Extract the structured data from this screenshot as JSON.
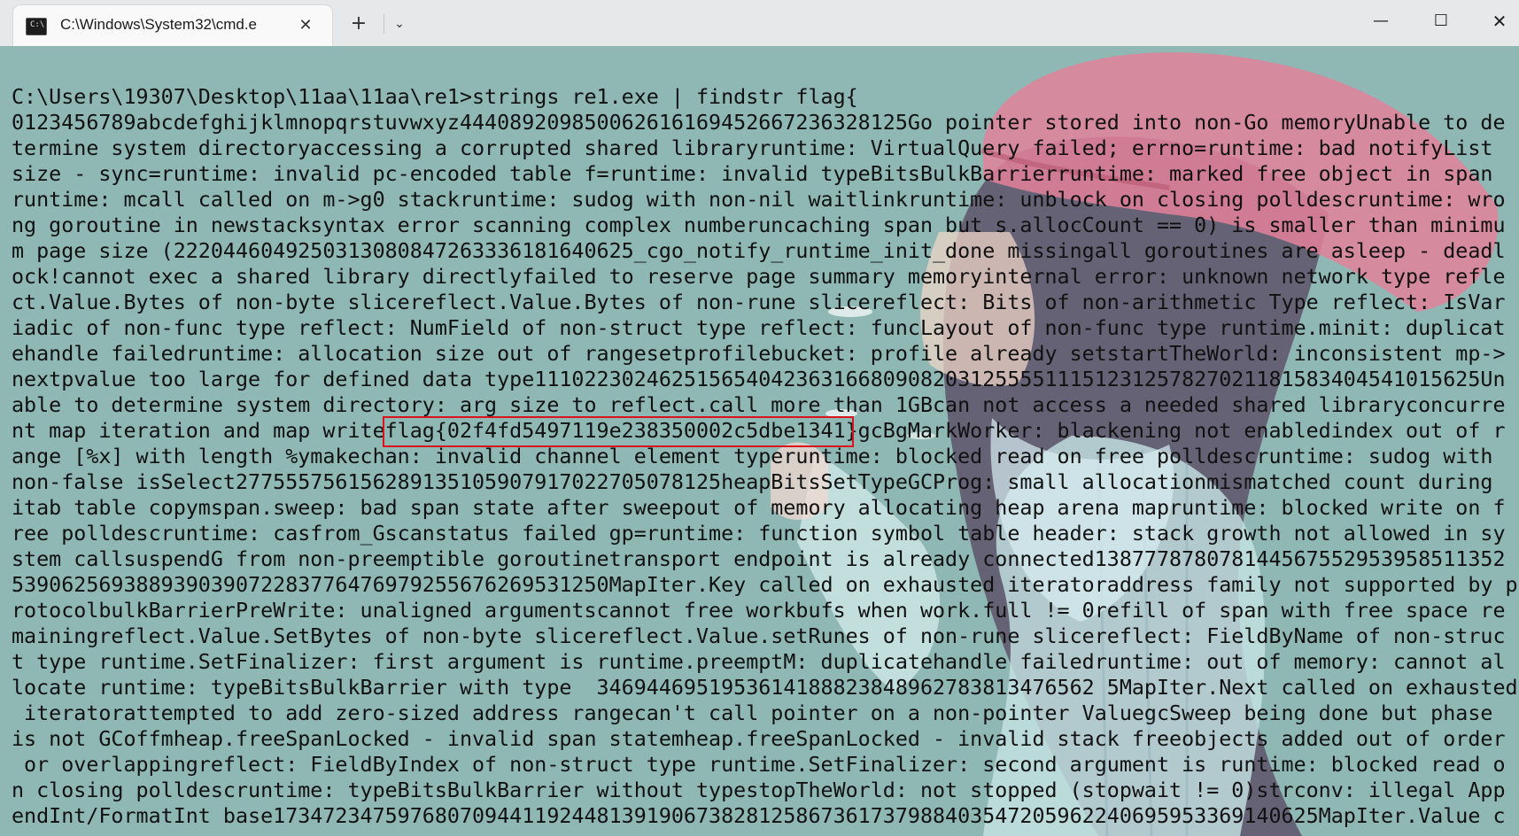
{
  "window": {
    "tab_title": "C:\\Windows\\System32\\cmd.e",
    "tab_icon_glyph": "C:\\",
    "close_tab_glyph": "✕",
    "new_tab_glyph": "+",
    "dropdown_glyph": "⌄",
    "minimize_glyph": "—",
    "maximize_glyph": "☐",
    "close_glyph": "✕"
  },
  "console": {
    "background_color": "#8fb8b5",
    "text_color": "#111111",
    "highlight_color": "#d8141c",
    "lines": [
      "C:\\Users\\19307\\Desktop\\11aa\\11aa\\re1>strings re1.exe | findstr flag{",
      "0123456789abcdefghijklmnopqrstuvwxyz444089209850062616169452667236328125Go pointer stored into non-Go memoryUnable to de",
      "termine system directoryaccessing a corrupted shared libraryruntime: VirtualQuery failed; errno=runtime: bad notifyList",
      "size - sync=runtime: invalid pc-encoded table f=runtime: invalid typeBitsBulkBarrierruntime: marked free object in span",
      "runtime: mcall called on m->g0 stackruntime: sudog with non-nil waitlinkruntime: unblock on closing polldescruntime: wro",
      "ng goroutine in newstacksyntax error scanning complex numberuncaching span but s.allocCount == 0) is smaller than minimu",
      "m page size (2220446049250313080847263336181640625_cgo_notify_runtime_init_done missingall goroutines are asleep - deadl",
      "ock!cannot exec a shared library directlyfailed to reserve page summary memoryinternal error: unknown network type refle",
      "ct.Value.Bytes of non-byte slicereflect.Value.Bytes of non-rune slicereflect: Bits of non-arithmetic Type reflect: IsVar",
      "iadic of non-func type reflect: NumField of non-struct type reflect: funcLayout of non-func type runtime.minit: duplicat",
      "ehandle failedruntime: allocation size out of rangesetprofilebucket: profile already setstartTheWorld: inconsistent mp->",
      "nextpvalue too large for defined data type1110223024625156540423631668090820312555511151231257827021181583404541015625Un",
      "able to determine system directory: arg size to reflect.call more than 1GBcan not access a needed shared libraryconcurre",
      "nt map iteration and map writeflag{02f4fd5497119e238350002c5dbe1341}gcBgMarkWorker: blackening not enabledindex out of r",
      "ange [%x] with length %ymakechan: invalid channel element typeruntime: blocked read on free polldescruntime: sudog with",
      "non-false isSelect277555756156289135105907917022705078125heapBitsSetTypeGCProg: small allocationmismatched count during",
      "itab table copymspan.sweep: bad span state after sweepout of memory allocating heap arena mapruntime: blocked write on f",
      "ree polldescruntime: casfrom_Gscanstatus failed gp=runtime: function symbol table header: stack growth not allowed in sy",
      "stem callsuspendG from non-preemptible goroutinetransport endpoint is already connected138777878078144567552953958511352",
      "539062569388939039072283776476979255676269531250MapIter.Key called on exhausted iteratoraddress family not supported by p",
      "rotocolbulkBarrierPreWrite: unaligned argumentscannot free workbufs when work.full != 0refill of span with free space re",
      "mainingreflect.Value.SetBytes of non-byte slicereflect.Value.setRunes of non-rune slicereflect: FieldByName of non-struc",
      "t type runtime.SetFinalizer: first argument is runtime.preemptM: duplicatehandle failedruntime: out of memory: cannot al",
      "locate runtime: typeBitsBulkBarrier with type  3469446951953614188823848962783813476562 5MapIter.Next called on exhausted",
      " iteratorattempted to add zero-sized address rangecan't call pointer on a non-pointer ValuegcSweep being done but phase",
      "is not GCoffmheap.freeSpanLocked - invalid span statemheap.freeSpanLocked - invalid stack freeobjects added out of order",
      " or overlappingreflect: FieldByIndex of non-struct type runtime.SetFinalizer: second argument is runtime: blocked read o",
      "n closing polldescruntime: typeBitsBulkBarrier without typestopTheWorld: not stopped (stopwait != 0)strconv: illegal App",
      "endInt/FormatInt base173472347597680709441192448139190673828125867361737988403547205962240695953369140625MapIter.Value c"
    ]
  }
}
